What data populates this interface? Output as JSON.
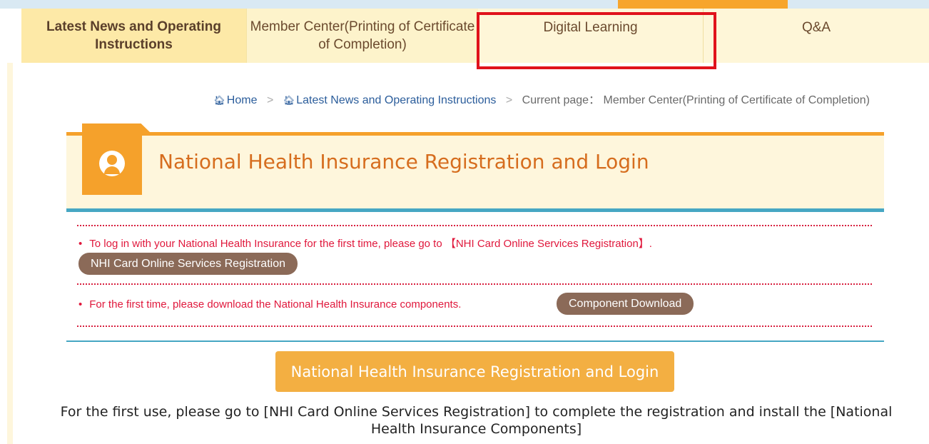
{
  "nav": {
    "tabs": [
      {
        "label": "Latest News and Operating Instructions"
      },
      {
        "label": "Member Center(Printing of Certificate of Completion)"
      },
      {
        "label": "Digital Learning"
      },
      {
        "label": "Q&A"
      }
    ]
  },
  "breadcrumb": {
    "home": "Home",
    "separator": ">",
    "section": "Latest News and Operating Instructions",
    "current_prefix": "Current page：",
    "current": "Member Center(Printing of Certificate of Completion)"
  },
  "panel": {
    "title": "National Health Insurance Registration and Login",
    "icon": "user-icon"
  },
  "notices": [
    {
      "text": "To log in with your National Health Insurance for the first time, please go to 【NHI Card Online Services Registration】.",
      "button": "NHI Card Online Services Registration"
    },
    {
      "text": "For the first time, please download the National Health Insurance components.",
      "button": "Component Download"
    }
  ],
  "login_button": "National Health Insurance Registration and Login",
  "first_use_text": "For the first use, please go to [NHI Card Online Services Registration] to complete the registration and install the [National Health Insurance Components]",
  "colors": {
    "accent_orange": "#f5a12b",
    "accent_blue": "#46a7c3",
    "notice_red": "#e0183c",
    "pill_brown": "#8b6a58",
    "highlight_red": "#e0121b"
  }
}
